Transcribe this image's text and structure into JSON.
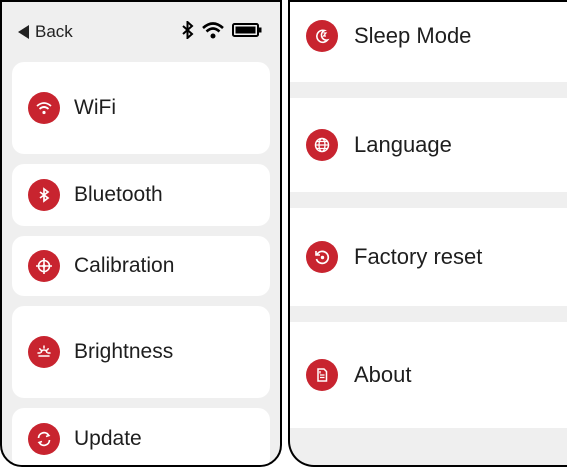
{
  "left_panel": {
    "back_label": "Back",
    "status_icons": [
      "bluetooth-icon",
      "wifi-icon",
      "battery-icon"
    ],
    "items": [
      {
        "label": "WiFi",
        "icon": "wifi-icon"
      },
      {
        "label": "Bluetooth",
        "icon": "bluetooth-icon"
      },
      {
        "label": "Calibration",
        "icon": "crosshair-icon"
      },
      {
        "label": "Brightness",
        "icon": "brightness-icon"
      },
      {
        "label": "Update",
        "icon": "update-icon"
      }
    ]
  },
  "right_panel": {
    "items": [
      {
        "label": "Sleep Mode",
        "icon": "moon-icon"
      },
      {
        "label": "Language",
        "icon": "globe-icon"
      },
      {
        "label": "Factory reset",
        "icon": "reset-icon"
      },
      {
        "label": "About",
        "icon": "info-document-icon"
      }
    ]
  },
  "colors": {
    "accent": "#c8242f",
    "background": "#efefef",
    "card": "#ffffff"
  }
}
